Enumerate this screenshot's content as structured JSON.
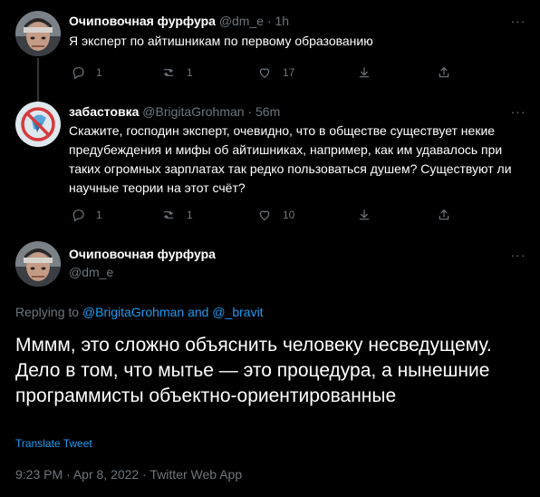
{
  "colors": {
    "background": "#000000",
    "text_primary": "#ffffff",
    "text_secondary": "#6e767d",
    "link": "#1d9bf0"
  },
  "tweets": [
    {
      "display_name": "Очиповочная фурфура",
      "handle": "@dm_e",
      "time": "1h",
      "text": "Я эксперт по айтишникам по первому образованию",
      "actions": {
        "replies": "1",
        "retweets": "1",
        "likes": "17"
      }
    },
    {
      "display_name": "забастовка",
      "handle": "@BrigitaGrohman",
      "time": "56m",
      "text": "Скажите, господин эксперт, очевидно, что в обществе существует некие предубеждения и мифы об айтишниках, например, как им удавалось при таких огромных зарплатах так редко пользоваться душем? Существуют ли научные теории на этот счёт?",
      "actions": {
        "replies": "1",
        "retweets": "1",
        "likes": "10"
      }
    }
  ],
  "main_tweet": {
    "display_name": "Очиповочная фурфура",
    "handle": "@dm_e",
    "replying_prefix": "Replying to ",
    "replying_user1": "@BrigitaGrohman",
    "replying_and": " and ",
    "replying_user2": "@_bravit",
    "text": "Мммм, это сложно объяснить человеку несведущему. Дело в том, что мытье — это процедура, а нынешние программисты объектно-ориентированные",
    "translate_label": "Translate Tweet",
    "time": "9:23 PM",
    "date": "Apr 8, 2022",
    "source": "Twitter Web App"
  },
  "ui": {
    "dot": "·",
    "more": "···"
  }
}
